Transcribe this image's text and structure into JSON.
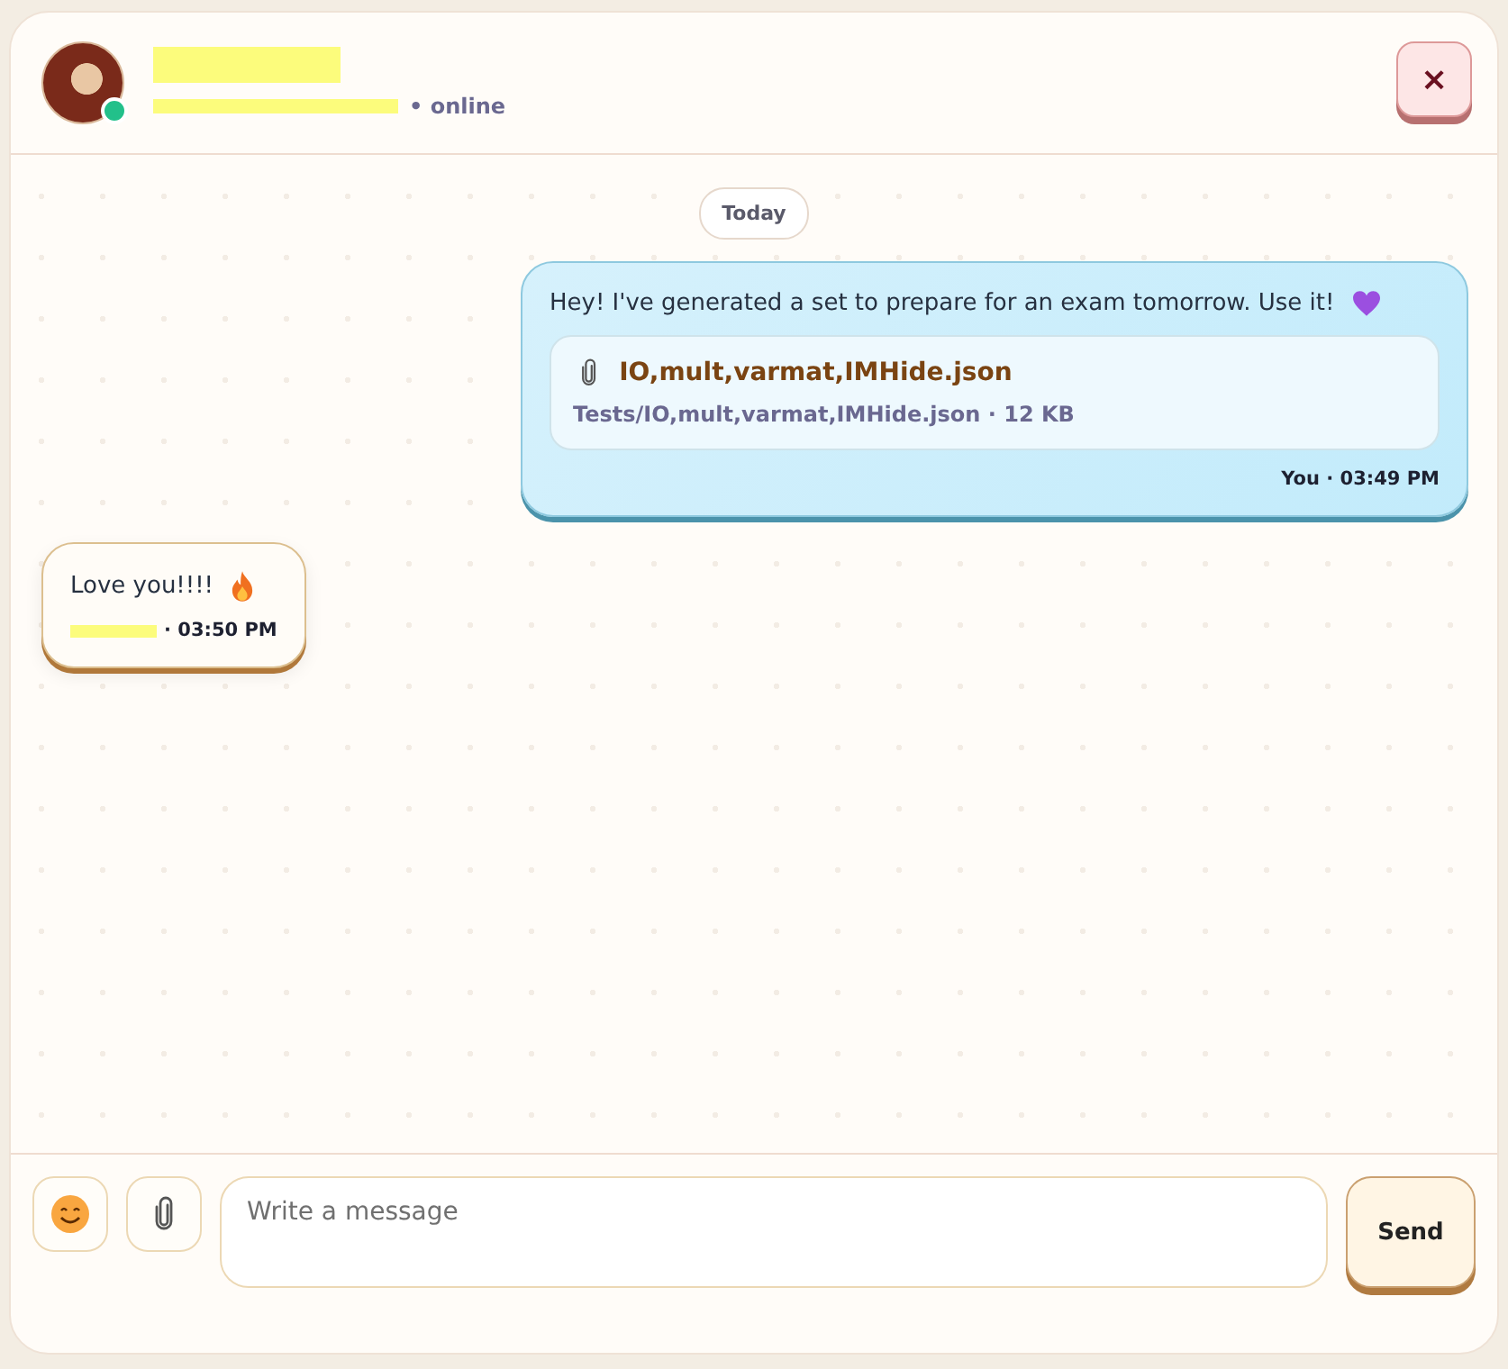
{
  "header": {
    "status": "• online",
    "online": true,
    "close_label": "×"
  },
  "date_divider": "Today",
  "messages": [
    {
      "kind": "outgoing",
      "text": "Hey! I've generated a set to prepare for an exam tomorrow. Use it!",
      "attachment": {
        "name": "IO,mult,varmat,IMHide.json",
        "path": "Tests/IO,mult,varmat,IMHide.json · 12 KB"
      },
      "meta": "You · 03:49 PM"
    },
    {
      "kind": "incoming",
      "text": "Love you!!!!",
      "meta": "· 03:50 PM"
    }
  ],
  "composer": {
    "placeholder": "Write a message",
    "send_label": "Send"
  }
}
